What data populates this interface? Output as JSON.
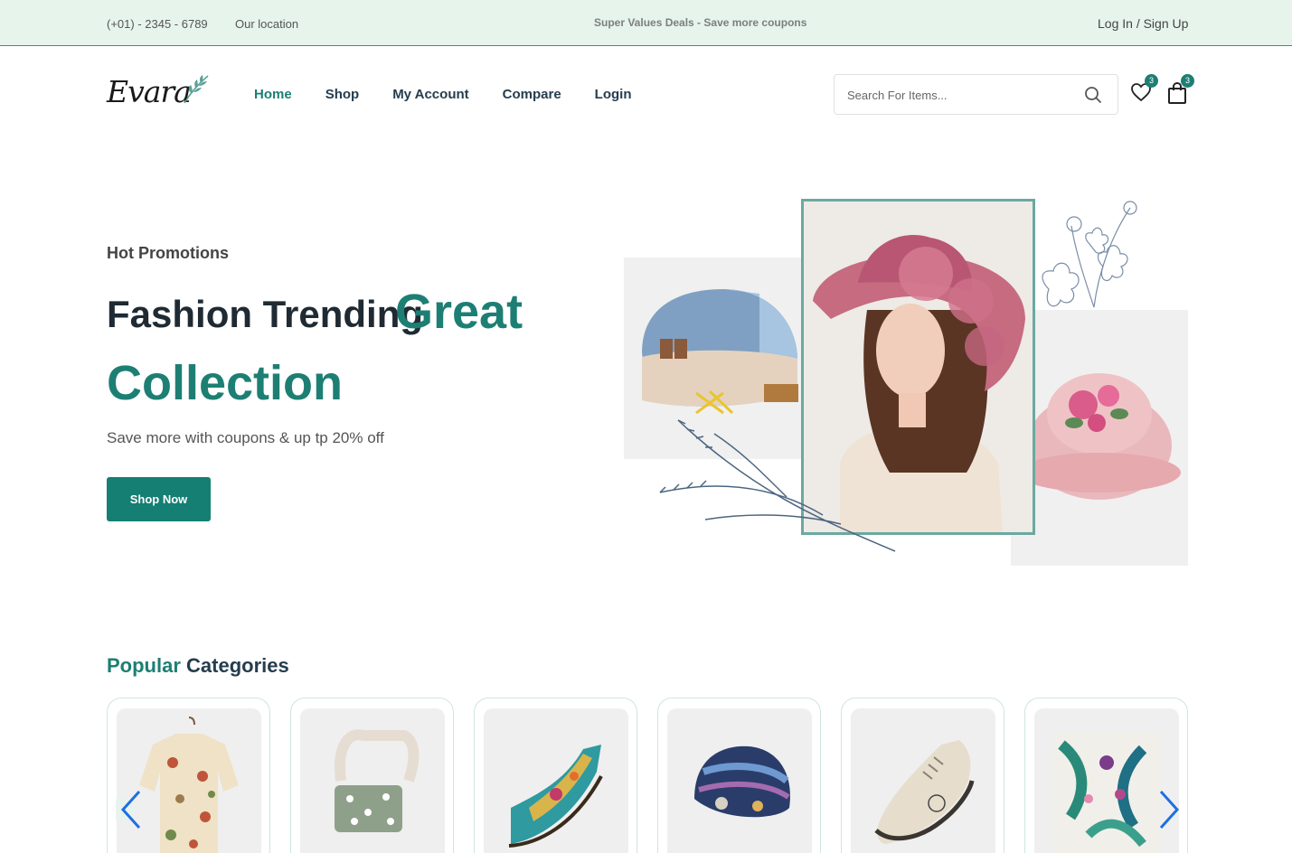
{
  "topbar": {
    "phone": "(+01) - 2345 - 6789",
    "location": "Our location",
    "deals": "Super Values Deals - Save more coupons",
    "login": "Log In / Sign Up"
  },
  "logo": {
    "text": "Evara"
  },
  "nav": {
    "items": [
      {
        "label": "Home",
        "active": true
      },
      {
        "label": "Shop"
      },
      {
        "label": "My Account"
      },
      {
        "label": "Compare"
      },
      {
        "label": "Login"
      }
    ]
  },
  "search": {
    "placeholder": "Search For Items..."
  },
  "header": {
    "wishlist_count": "3",
    "cart_count": "3"
  },
  "hero": {
    "kicker": "Hot Promotions",
    "title_part1": "Fashion Trending",
    "title_part2": "Great",
    "title_part3": "Collection",
    "subtitle": "Save more with coupons & up tp 20% off",
    "cta": "Shop Now"
  },
  "categories": {
    "title_accent": "Popular",
    "title_rest": "Categories",
    "items": [
      {
        "icon": "shirt-image"
      },
      {
        "icon": "bag-image"
      },
      {
        "icon": "sandal-image"
      },
      {
        "icon": "beanie-image"
      },
      {
        "icon": "sneaker-image"
      },
      {
        "icon": "pillow-image"
      }
    ]
  },
  "colors": {
    "accent": "#1d7f73",
    "topbar_bg": "#e6f4ec",
    "button": "#147f72"
  }
}
